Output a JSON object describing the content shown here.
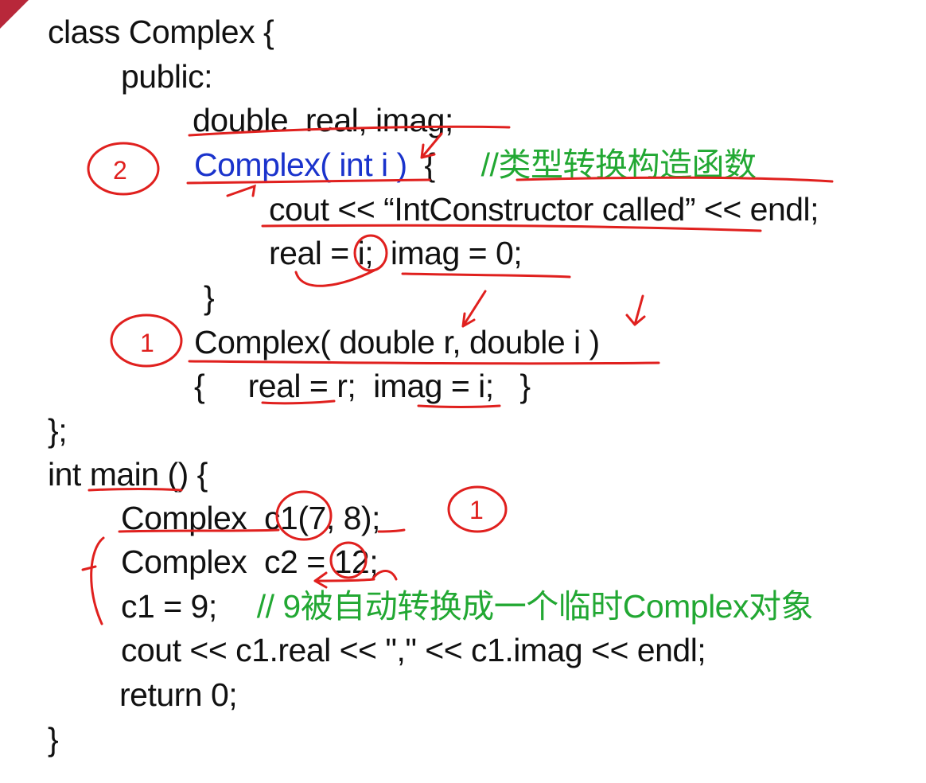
{
  "code": {
    "l1": "class Complex {",
    "l2": "public:",
    "l3": "double  real, imag;",
    "l4_code": "Complex( int i )",
    "l4_brace": "  {",
    "l4_comment": "//类型转换构造函数",
    "l5": "cout << “IntConstructor called” << endl;",
    "l6": "real = i;  imag = 0;",
    "l7": "}",
    "l8": "Complex( double r, double i )",
    "l9": "{     real = r;  imag = i;   }",
    "l10": "};",
    "l11": "int main () {",
    "l12": "Complex  c1(7, 8);",
    "l13": "Complex  c2 = 12;",
    "l14_code": "c1 = 9;",
    "l14_comment": "// 9被自动转换成一个临时Complex对象",
    "l15": "cout << c1.real << \",\" << c1.imag << endl;",
    "l16": "return 0;",
    "l17": "}"
  },
  "annotations": {
    "mark_two": "2",
    "mark_one_a": "1",
    "mark_one_b": "1"
  },
  "colors": {
    "code": "#111111",
    "constructor": "#1a33cc",
    "comment": "#22a833",
    "ink": "#e0201e"
  }
}
